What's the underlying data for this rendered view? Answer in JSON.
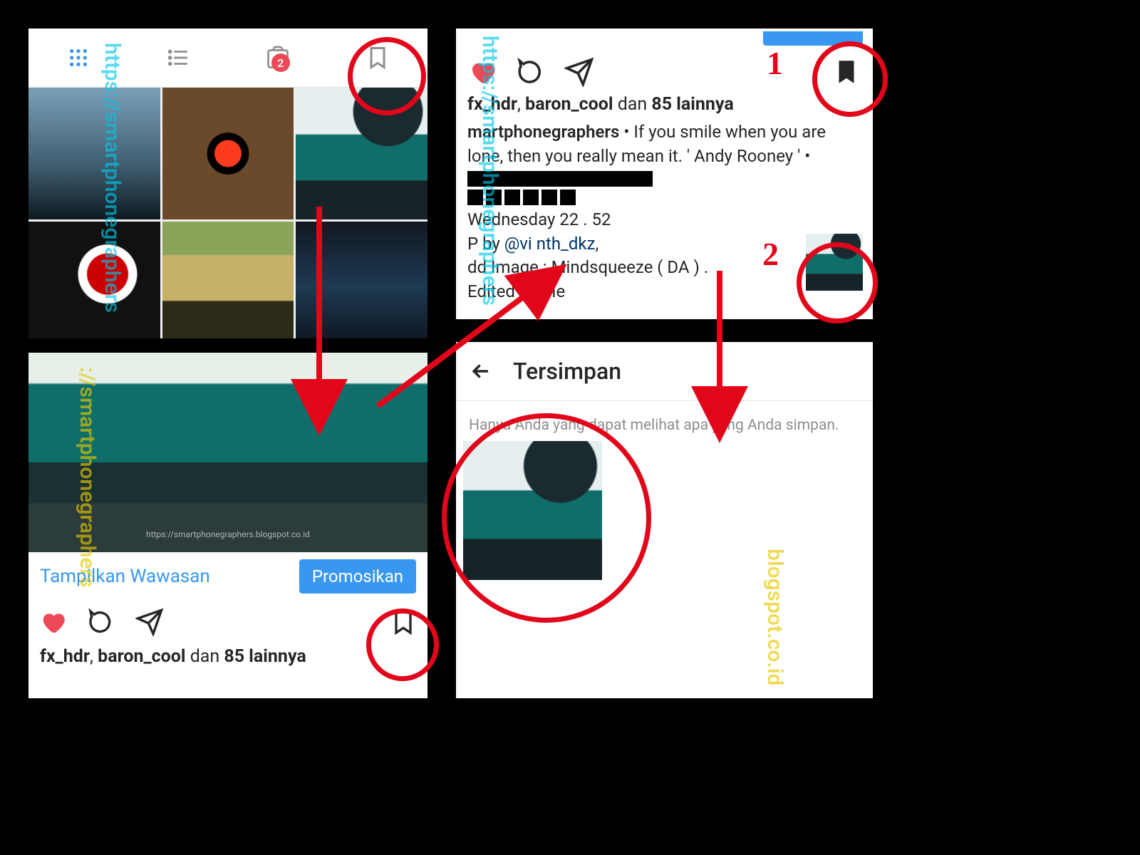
{
  "watermark_main": "https://smartphonegraphers",
  "watermark_alt": "://smartphonegraphers",
  "watermark_br": "blogspot.co.id",
  "watermark_inphoto": "https://smartphonegraphers.blogspot.co.id",
  "profile": {
    "badge_count": "2"
  },
  "post": {
    "insights_link": "Tampilkan Wawasan",
    "promote_btn": "Promosikan",
    "likes_prefix": "fx_hdr",
    "likes_mid": ", ",
    "likes_user2": "baron_cool",
    "likes_conj": " dan ",
    "likes_count": "85 lainnya"
  },
  "detail": {
    "likes_prefix": "fx_hdr",
    "likes_user2": "baron_cool",
    "likes_conj": " dan ",
    "likes_count": "85 lainnya",
    "author": "martphonegraphers",
    "caption_line1": " • If you smile when you are ",
    "caption_line2": "lone, then you really mean it. ' Andy Rooney ' •",
    "time_line": "Wednesday 22 . 52",
    "credit_pre": "P by ",
    "credit_user": "@vi     nth_dkz",
    "credit_comma": ",",
    "addimg": "dd Image : Mindsqueeze ( DA ) .",
    "edited": "Edited by Me"
  },
  "saved": {
    "title": "Tersimpan",
    "hint": "Hanya Anda yang dapat melihat apa yang Anda simpan."
  },
  "annot": {
    "n1": "1",
    "n2": "2"
  }
}
